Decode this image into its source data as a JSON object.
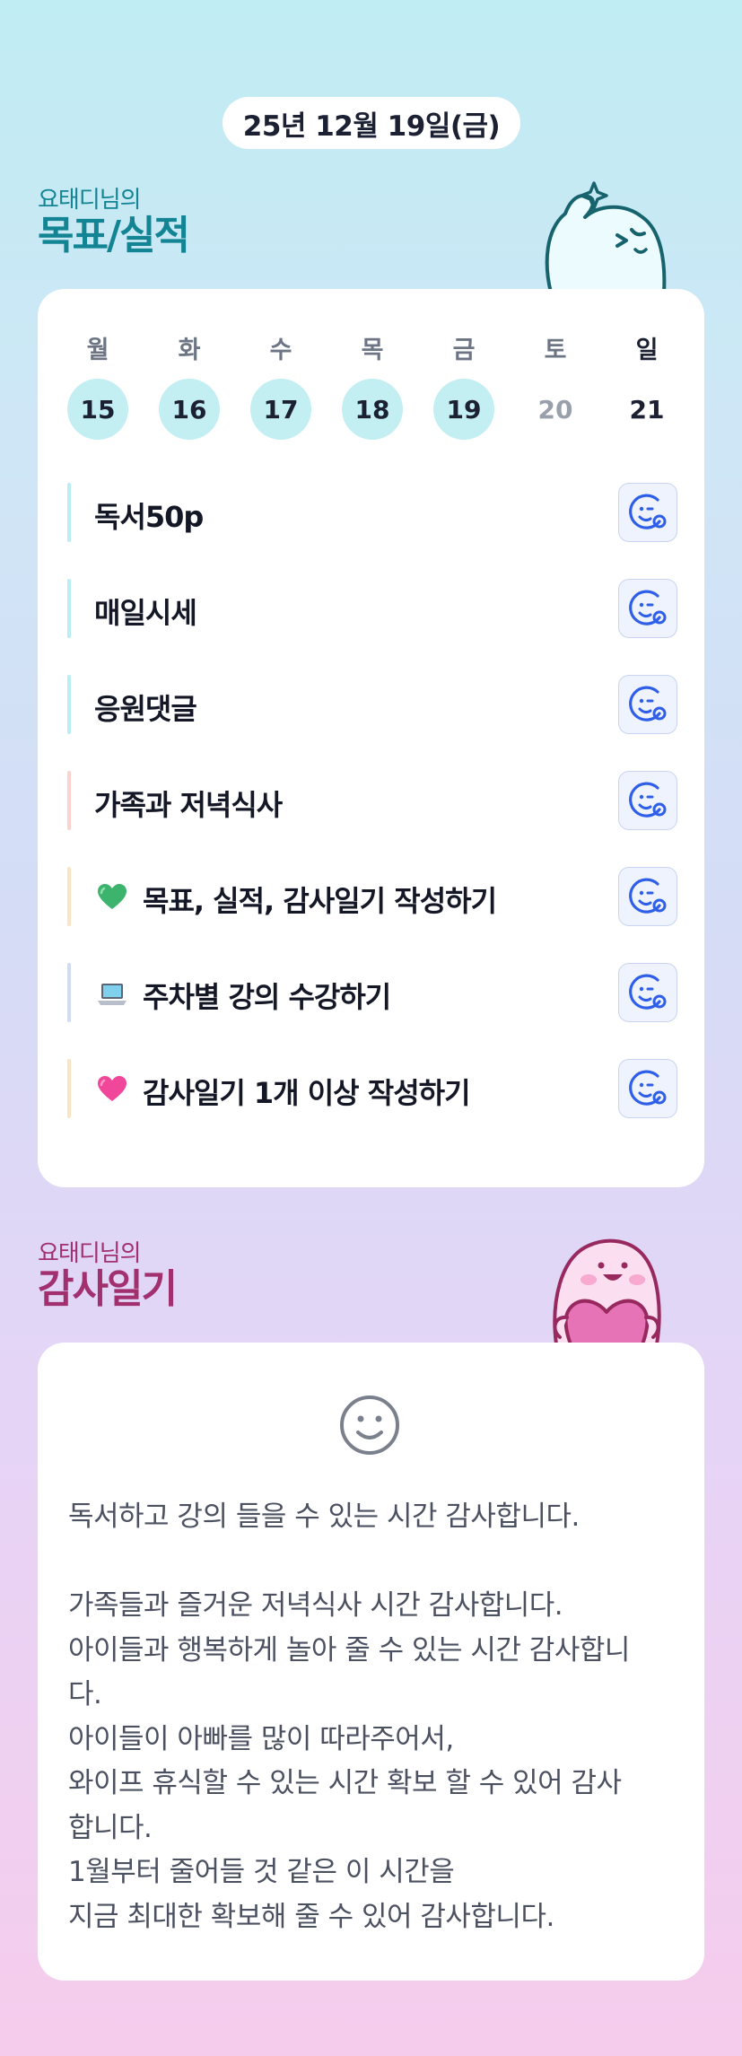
{
  "header": {
    "date": "25년 12월 19일(금)"
  },
  "goals": {
    "title_sub": "요태디님의",
    "title_main": "목표/실적",
    "week": [
      {
        "name": "월",
        "num": "15",
        "done": true
      },
      {
        "name": "화",
        "num": "16",
        "done": true
      },
      {
        "name": "수",
        "num": "17",
        "done": true
      },
      {
        "name": "목",
        "num": "18",
        "done": true
      },
      {
        "name": "금",
        "num": "19",
        "done": true
      },
      {
        "name": "토",
        "num": "20",
        "done": false
      },
      {
        "name": "일",
        "num": "21",
        "done": false
      }
    ],
    "tasks": [
      {
        "label": "독서50p",
        "bar_color": "#b9eef3"
      },
      {
        "label": "매일시세",
        "bar_color": "#b9eef3"
      },
      {
        "label": "응원댓글",
        "bar_color": "#b9eef3"
      },
      {
        "label": "가족과 저녁식사",
        "bar_color": "#f9d3cc"
      },
      {
        "label": "목표, 실적, 감사일기 작성하기",
        "bar_color": "#fbe3c3",
        "emoji": "green-heart-icon"
      },
      {
        "label": "주차별 강의 수강하기",
        "bar_color": "#cfdcf3",
        "emoji": "laptop-icon"
      },
      {
        "label": "감사일기 1개 이상 작성하기",
        "bar_color": "#fbe3c3",
        "emoji": "pink-heart-icon"
      }
    ],
    "feedback_icon": "smile-plus-icon"
  },
  "gratitude": {
    "title_sub": "요태디님의",
    "title_main": "감사일기",
    "mood_icon": "smile-face-icon",
    "lines": [
      "독서하고 강의 들을 수 있는 시간 감사합니다.",
      "",
      "가족들과 즐거운 저녁식사 시간 감사합니다.",
      "아이들과 행복하게 놀아 줄 수 있는 시간 감사합니",
      "다.",
      "아이들이 아빠를 많이 따라주어서,",
      "와이프 휴식할 수 있는 시간 확보 할 수 있어 감사",
      "합니다.",
      "1월부터 줄어들 것 같은 이 시간을",
      "지금 최대한 확보해 줄 수 있어 감사합니다."
    ]
  },
  "colors": {
    "accent_teal": "#138493",
    "accent_magenta": "#a2306f",
    "done_circle": "#c3eff3",
    "feedback_blue": "#2f5ee8"
  }
}
